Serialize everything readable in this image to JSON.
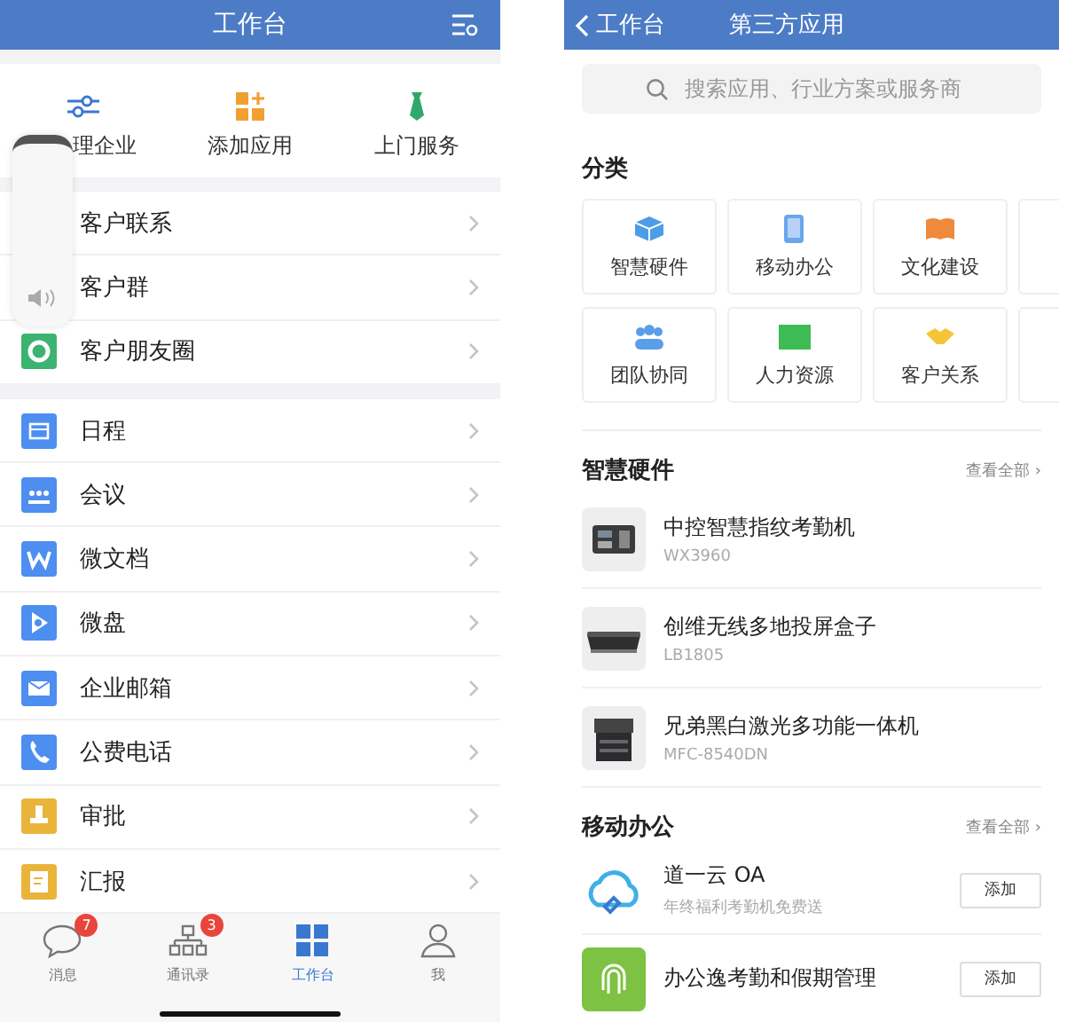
{
  "left": {
    "header": {
      "title": "工作台"
    },
    "quick_actions": [
      {
        "label": "理企业"
      },
      {
        "label": "添加应用"
      },
      {
        "label": "上门服务"
      }
    ],
    "groups": [
      {
        "items": [
          {
            "label": "客户联系"
          },
          {
            "label": "客户群"
          },
          {
            "label": "客户朋友圈"
          }
        ]
      },
      {
        "items": [
          {
            "label": "日程"
          },
          {
            "label": "会议"
          },
          {
            "label": "微文档"
          },
          {
            "label": "微盘"
          },
          {
            "label": "企业邮箱"
          },
          {
            "label": "公费电话"
          },
          {
            "label": "审批"
          },
          {
            "label": "汇报"
          }
        ]
      }
    ],
    "tab_bar": [
      {
        "label": "消息",
        "badge": "7",
        "selected": false
      },
      {
        "label": "通讯录",
        "badge": "3",
        "selected": false
      },
      {
        "label": "工作台",
        "selected": true
      },
      {
        "label": "我",
        "selected": false
      }
    ]
  },
  "right": {
    "header": {
      "back_label": "工作台",
      "title": "第三方应用"
    },
    "search": {
      "placeholder": "搜索应用、行业方案或服务商"
    },
    "categories_title": "分类",
    "categories": [
      {
        "label": "智慧硬件"
      },
      {
        "label": "移动办公"
      },
      {
        "label": "文化建设"
      },
      {
        "label": "团队协同"
      },
      {
        "label": "人力资源"
      },
      {
        "label": "客户关系"
      }
    ],
    "sections": [
      {
        "title": "智慧硬件",
        "see_all": "查看全部 ›",
        "items": [
          {
            "kind": "product",
            "name": "中控智慧指纹考勤机",
            "subtitle": "WX3960"
          },
          {
            "kind": "product",
            "name": "创维无线多地投屏盒子",
            "subtitle": "LB1805"
          },
          {
            "kind": "product",
            "name": "兄弟黑白激光多功能一体机",
            "subtitle": "MFC-8540DN"
          }
        ]
      },
      {
        "title": "移动办公",
        "see_all": "查看全部 ›",
        "items": [
          {
            "kind": "app",
            "name": "道一云 OA",
            "subtitle": "年终福利考勤机免费送",
            "action": "添加"
          },
          {
            "kind": "app",
            "name": "办公逸考勤和假期管理",
            "action": "添加"
          }
        ]
      }
    ]
  }
}
